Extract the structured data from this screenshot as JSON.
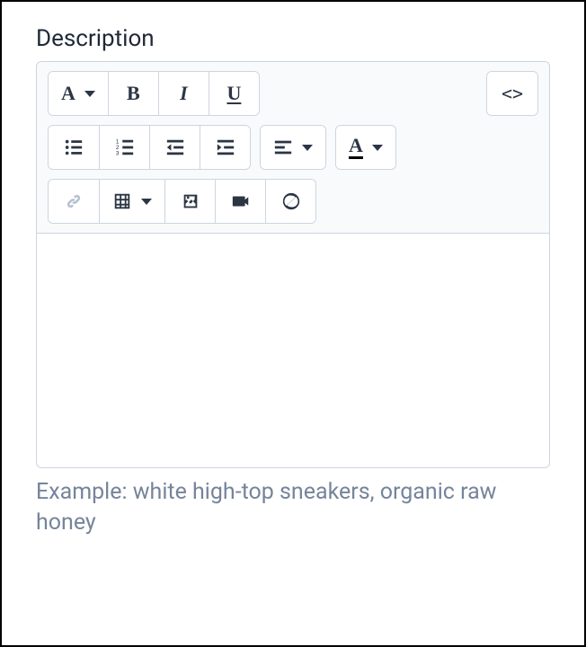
{
  "field": {
    "label": "Description",
    "helper": "Example: white high-top sneakers, organic raw honey"
  },
  "toolbar": {
    "font_label": "A",
    "bold_label": "B",
    "italic_label": "I",
    "underline_label": "U",
    "code_label": "<>",
    "text_color_label": "A"
  }
}
